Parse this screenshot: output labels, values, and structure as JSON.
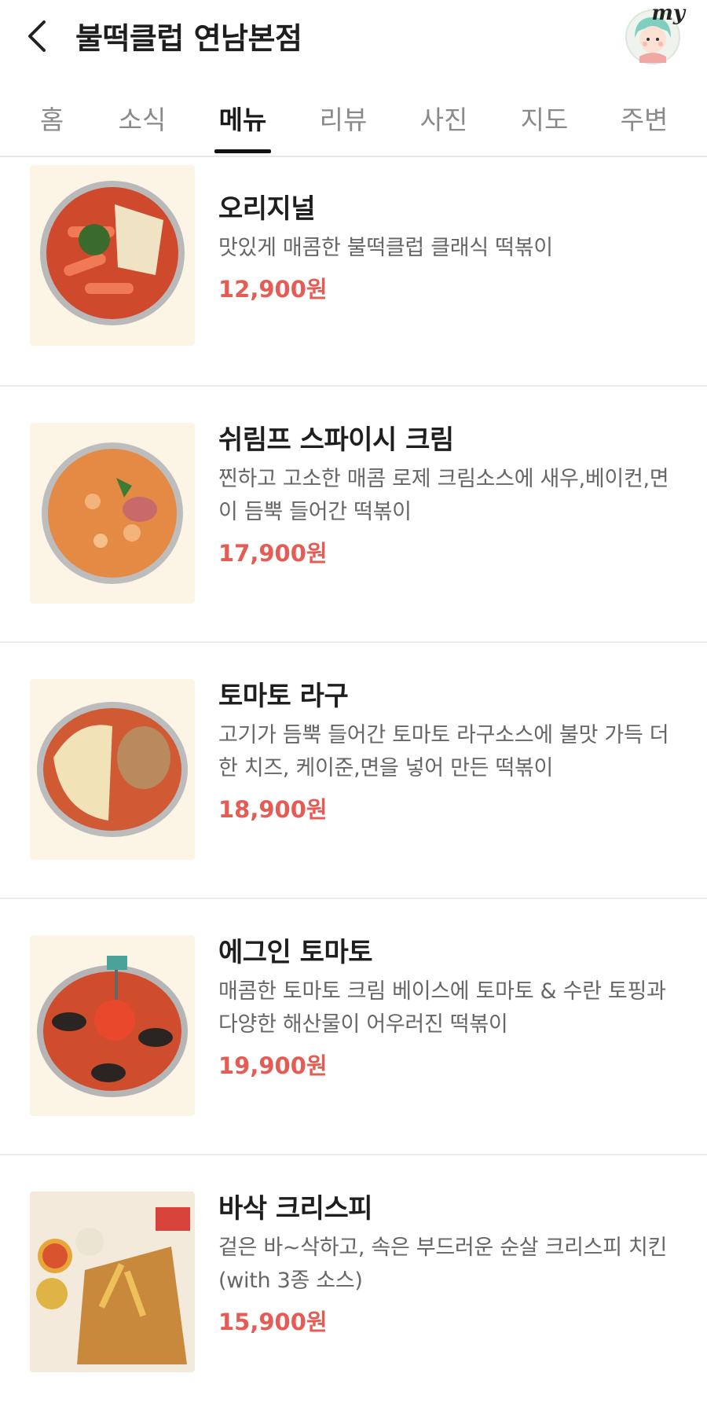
{
  "header": {
    "title": "불떡클럽 연남본점",
    "my_label": "my"
  },
  "tabs": [
    {
      "label": "홈"
    },
    {
      "label": "소식"
    },
    {
      "label": "메뉴",
      "active": true
    },
    {
      "label": "리뷰"
    },
    {
      "label": "사진"
    },
    {
      "label": "지도"
    },
    {
      "label": "주변"
    }
  ],
  "menu": [
    {
      "name": "오리지널",
      "desc": "맛있게 매콤한 불떡클럽 클래식 떡볶이",
      "price": "12,900원"
    },
    {
      "name": "쉬림프 스파이시 크림",
      "desc": "찐하고 고소한 매콤 로제 크림소스에 새우,베이컨,면이 듬뿍 들어간 떡볶이",
      "price": "17,900원"
    },
    {
      "name": "토마토 라구",
      "desc": "고기가 듬뿍 들어간 토마토 라구소스에 불맛 가득 더한 치즈, 케이준,면을 넣어 만든 떡볶이",
      "price": "18,900원"
    },
    {
      "name": "에그인 토마토",
      "desc": "매콤한 토마토 크림 베이스에 토마토 & 수란 토핑과 다양한 해산물이 어우러진 떡볶이",
      "price": "19,900원"
    },
    {
      "name": "바삭 크리스피",
      "desc": "겉은 바~삭하고, 속은 부드러운 순살 크리스피 치킨 (with 3종 소스)",
      "price": "15,900원"
    }
  ]
}
